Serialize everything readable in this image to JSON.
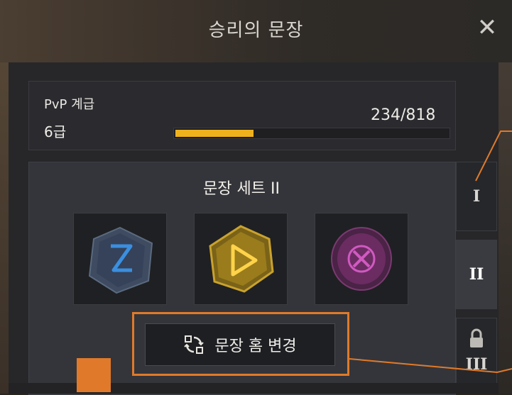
{
  "window": {
    "title": "승리의 문장",
    "close_icon": "close-icon"
  },
  "rank": {
    "label": "PvP 계급",
    "value": "6급",
    "progress_text": "234/818",
    "progress_fraction": 0.286,
    "bar_color": "#f0b21c"
  },
  "emblem_set": {
    "title": "문장 세트 II",
    "slots": [
      {
        "icon": "blue-hourglass-rune-icon",
        "color": "#3a8fe0"
      },
      {
        "icon": "gold-play-rune-icon",
        "color": "#e3b21f"
      },
      {
        "icon": "magenta-cross-rune-icon",
        "color": "#c04bb0"
      }
    ]
  },
  "tabs": [
    {
      "label": "I"
    },
    {
      "label": "II",
      "active": true
    },
    {
      "label": "III",
      "locked": true,
      "icon": "lock-icon"
    }
  ],
  "change_button": {
    "label": "문장 홈 변경",
    "icon": "swap-icon"
  },
  "annotation": {
    "highlight_color": "#e07a2a"
  }
}
